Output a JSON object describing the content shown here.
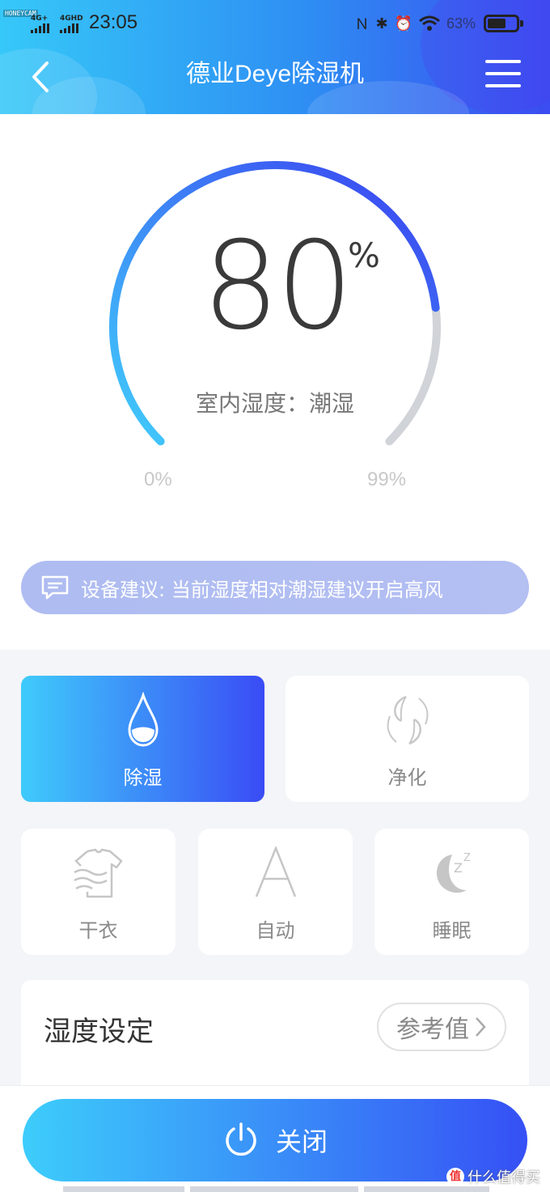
{
  "status_bar": {
    "watermark": "HONEYCAM",
    "sim1": "4G+",
    "sim2": "4GHD",
    "time": "23:05",
    "battery_pct": "63%"
  },
  "header": {
    "title": "德业Deye除湿机"
  },
  "gauge": {
    "value": "80",
    "unit": "%",
    "status": "室内湿度：潮湿",
    "min_label": "0%",
    "max_label": "99%",
    "percent": 80
  },
  "advice": {
    "text": "设备建议: 当前湿度相对潮湿建议开启高风"
  },
  "modes": {
    "dehumidify": "除湿",
    "purify": "净化",
    "dry_clothes": "干衣",
    "auto": "自动",
    "sleep": "睡眠"
  },
  "setting": {
    "title": "湿度设定",
    "reference": "参考值"
  },
  "power": {
    "label": "关闭"
  },
  "footer": {
    "watermark": "什么值得买"
  },
  "colors": {
    "accent_start": "#36c8f8",
    "accent_end": "#3b4cf0",
    "track": "#d0d3d8"
  }
}
